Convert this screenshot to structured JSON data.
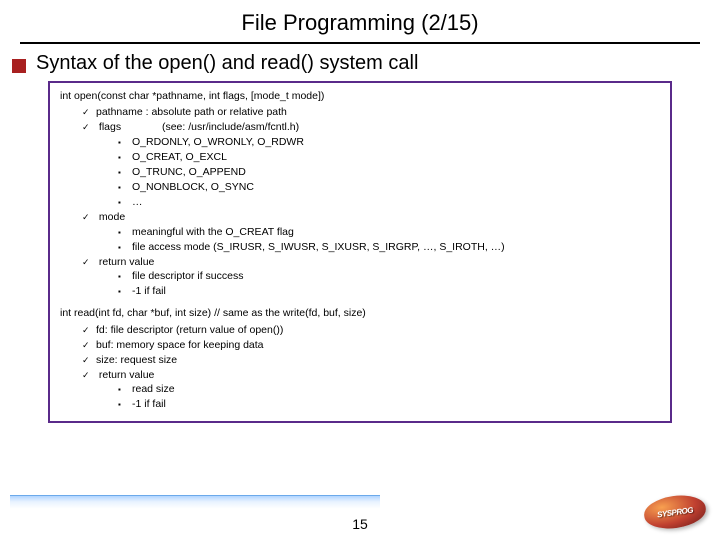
{
  "title": "File Programming (2/15)",
  "main_bullet": "Syntax of the open() and read() system call",
  "open": {
    "signature": "int open(const char *pathname, int flags, [mode_t mode])",
    "items": {
      "pathname": "pathname : absolute path or relative path",
      "flags_label": "flags",
      "flags_note": "(see: /usr/include/asm/fcntl.h)",
      "flag_lines": {
        "l1": "O_RDONLY, O_WRONLY, O_RDWR",
        "l2": "O_CREAT, O_EXCL",
        "l3": "O_TRUNC, O_APPEND",
        "l4": "O_NONBLOCK, O_SYNC",
        "l5": "…"
      },
      "mode_label": "mode",
      "mode_lines": {
        "m1": "meaningful with the O_CREAT flag",
        "m2": "file access mode (S_IRUSR, S_IWUSR, S_IXUSR, S_IRGRP, …, S_IROTH, …)"
      },
      "ret_label": "return value",
      "ret_lines": {
        "r1": "file descriptor if success",
        "r2": "-1 if fail"
      }
    }
  },
  "read": {
    "signature": "int read(int fd, char *buf, int size)  // same as the write(fd, buf, size)",
    "items": {
      "fd": "fd: file descriptor (return value of open())",
      "buf": "buf: memory space for keeping data",
      "size": "size: request size",
      "ret_label": "return value",
      "ret_lines": {
        "r1": "read size",
        "r2": "-1 if fail"
      }
    }
  },
  "page_number": "15",
  "logo_text": "SYSPROG"
}
